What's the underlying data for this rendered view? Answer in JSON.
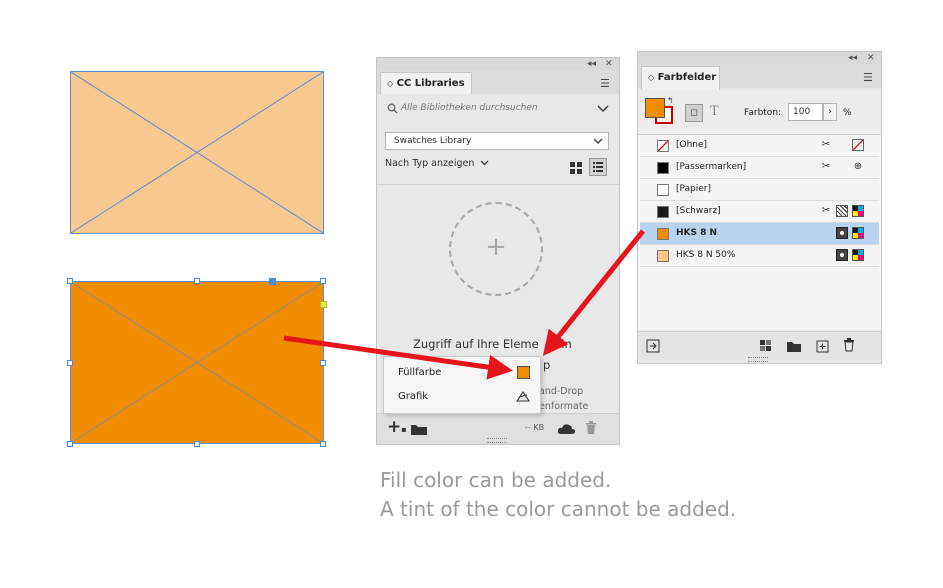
{
  "colors": {
    "light_orange": "#f9c98f",
    "orange": "#f08c00",
    "frame_line": "#5b8fd8",
    "arrow": "#e8141b",
    "selection": "#b9d2ee"
  },
  "cc_libraries": {
    "tab_title": "CC Libraries",
    "search_placeholder": "Alle Bibliotheken durchsuchen",
    "library_select": "Swatches Library",
    "view_by": "Nach Typ anzeigen",
    "access_text_1": "Zugriff auf Ihre Eleme",
    "access_text_1b": "te in",
    "access_text_2b": "p",
    "dd_text_1": "and-Drop",
    "dd_text_2": "enformate",
    "size_label": "-- KB"
  },
  "context_menu": {
    "items": [
      {
        "label": "Füllfarbe",
        "icon": "orange-swatch-icon"
      },
      {
        "label": "Grafik",
        "icon": "graphic-icon"
      }
    ]
  },
  "swatches": {
    "tab_title": "Farbfelder",
    "tint_label": "Farbton:",
    "tint_value": "100",
    "tint_unit": "%",
    "rows": [
      {
        "name": "[Ohne]",
        "chip": "none",
        "selected": false
      },
      {
        "name": "[Passermarken]",
        "chip": "#000000",
        "selected": false
      },
      {
        "name": "[Papier]",
        "chip": "#ffffff",
        "selected": false
      },
      {
        "name": "[Schwarz]",
        "chip": "#1a1a1a",
        "selected": false
      },
      {
        "name": "HKS 8 N",
        "chip": "#f08c00",
        "selected": true
      },
      {
        "name": "HKS 8 N 50%",
        "chip": "#f9c98f",
        "selected": false
      }
    ]
  },
  "caption": {
    "line1": "Fill color can be added.",
    "line2": "A tint of the color cannot be added."
  }
}
